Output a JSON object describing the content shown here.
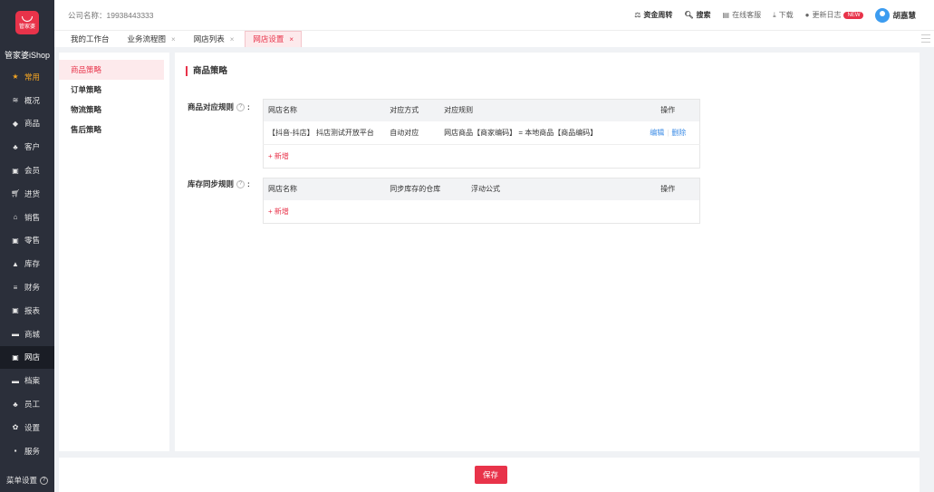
{
  "app": {
    "logo_text": "管家婆",
    "brand_name": "管家婆iShop",
    "company": "公司名称：19938443333"
  },
  "nav": {
    "items": [
      {
        "label": "常用",
        "icon": "star-icon"
      },
      {
        "label": "概况",
        "icon": "layers-icon"
      },
      {
        "label": "商品",
        "icon": "box-icon"
      },
      {
        "label": "客户",
        "icon": "user-icon"
      },
      {
        "label": "会员",
        "icon": "card-icon"
      },
      {
        "label": "进货",
        "icon": "cart-icon"
      },
      {
        "label": "销售",
        "icon": "bag-icon"
      },
      {
        "label": "零售",
        "icon": "shop-icon"
      },
      {
        "label": "库存",
        "icon": "warehouse-icon"
      },
      {
        "label": "财务",
        "icon": "finance-icon"
      },
      {
        "label": "报表",
        "icon": "report-icon"
      },
      {
        "label": "商城",
        "icon": "mall-icon"
      },
      {
        "label": "网店",
        "icon": "store-icon"
      },
      {
        "label": "档案",
        "icon": "folder-icon"
      },
      {
        "label": "员工",
        "icon": "staff-icon"
      },
      {
        "label": "设置",
        "icon": "gear-icon"
      },
      {
        "label": "服务",
        "icon": "service-icon"
      }
    ],
    "menu_settings": "菜单设置"
  },
  "topbar": {
    "funds": "资金周转",
    "search": "搜索",
    "service": "在线客服",
    "download": "下载",
    "changelog": "更新日志",
    "new_badge": "NEW",
    "user": "胡嘉慧"
  },
  "tabs": [
    {
      "label": "我的工作台",
      "closable": false
    },
    {
      "label": "业务流程图",
      "closable": true
    },
    {
      "label": "网店列表",
      "closable": true
    },
    {
      "label": "网店设置",
      "closable": true,
      "active": true
    }
  ],
  "subnav": {
    "items": [
      "商品策略",
      "订单策略",
      "物流策略",
      "售后策略"
    ]
  },
  "main": {
    "title": "商品策略",
    "product_rule": {
      "label": "商品对应规则",
      "headers": [
        "网店名称",
        "对应方式",
        "对应规则",
        "操作"
      ],
      "rows": [
        {
          "shop": "【抖音-抖店】 抖店测试开放平台",
          "method": "自动对应",
          "rule": "网店商品【商家编码】 = 本地商品【商品编码】",
          "edit": "编辑",
          "delete": "删除"
        }
      ],
      "add": "+ 新增"
    },
    "stock_rule": {
      "label": "库存同步规则",
      "headers": [
        "网店名称",
        "同步库存的仓库",
        "浮动公式",
        "操作"
      ],
      "add": "+ 新增"
    }
  },
  "footer": {
    "save": "保存"
  },
  "colors": {
    "accent": "#e8334a",
    "nav_bg": "#2b2f3a",
    "link": "#3c8ce6"
  }
}
